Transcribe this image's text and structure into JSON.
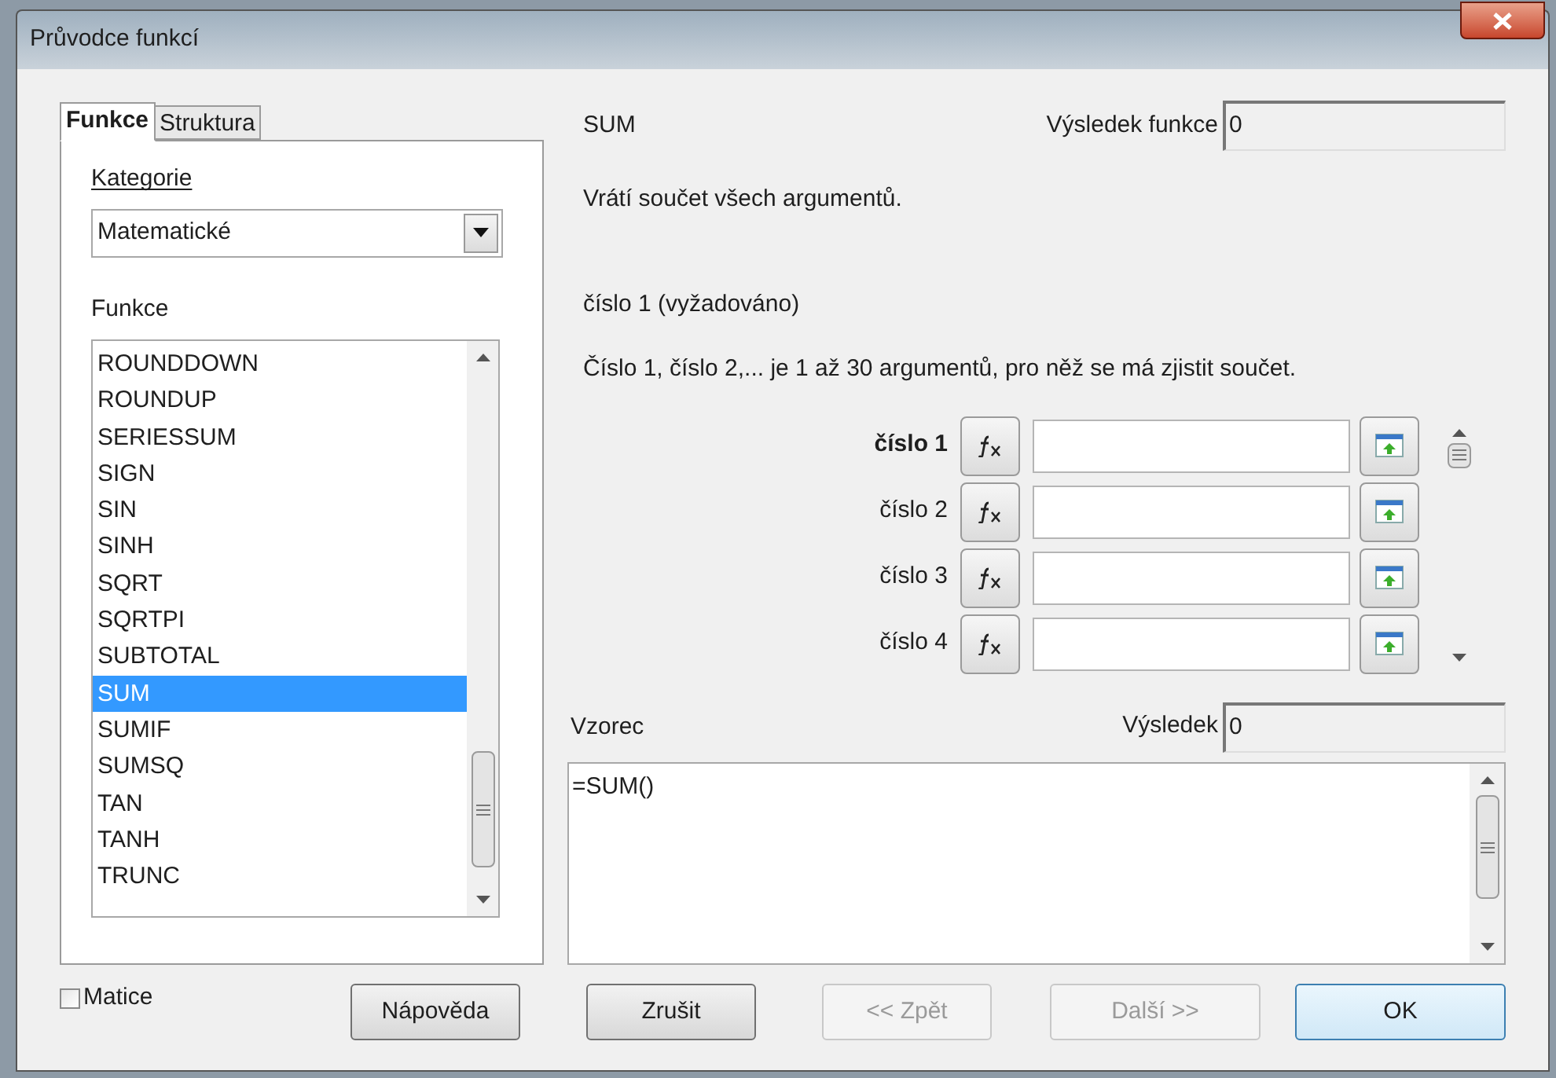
{
  "window": {
    "title": "Průvodce funkcí"
  },
  "tabs": [
    {
      "label": "Funkce",
      "selected": true
    },
    {
      "label": "Struktura",
      "selected": false
    }
  ],
  "category": {
    "label": "Kategorie",
    "value": "Matematické"
  },
  "functions": {
    "label": "Funkce",
    "items": [
      {
        "label": "ROUNDDOWN",
        "selected": false
      },
      {
        "label": "ROUNDUP",
        "selected": false
      },
      {
        "label": "SERIESSUM",
        "selected": false
      },
      {
        "label": "SIGN",
        "selected": false
      },
      {
        "label": "SIN",
        "selected": false
      },
      {
        "label": "SINH",
        "selected": false
      },
      {
        "label": "SQRT",
        "selected": false
      },
      {
        "label": "SQRTPI",
        "selected": false
      },
      {
        "label": "SUBTOTAL",
        "selected": false
      },
      {
        "label": "SUM",
        "selected": true
      },
      {
        "label": "SUMIF",
        "selected": false
      },
      {
        "label": "SUMSQ",
        "selected": false
      },
      {
        "label": "TAN",
        "selected": false
      },
      {
        "label": "TANH",
        "selected": false
      },
      {
        "label": "TRUNC",
        "selected": false
      }
    ]
  },
  "matrix": {
    "label": "Matice",
    "checked": false
  },
  "function_name": "SUM",
  "function_result": {
    "label": "Výsledek funkce",
    "value": "0"
  },
  "description": "Vrátí součet všech argumentů.",
  "argument_title": "číslo 1 (vyžadováno)",
  "argument_description": "Číslo 1, číslo 2,... je 1 až 30 argumentů, pro něž se má zjistit součet.",
  "arguments": [
    {
      "label": "číslo 1",
      "selected": true
    },
    {
      "label": "číslo 2",
      "selected": false
    },
    {
      "label": "číslo 3",
      "selected": false
    },
    {
      "label": "číslo 4",
      "selected": false
    }
  ],
  "formula": {
    "label": "Vzorec",
    "value": "=SUM()"
  },
  "result": {
    "label": "Výsledek",
    "value": "0"
  },
  "buttons": [
    {
      "label": "Nápověda",
      "disabled": false,
      "default": false
    },
    {
      "label": "Zrušit",
      "disabled": false,
      "default": false
    },
    {
      "label": "<< Zpět",
      "disabled": true,
      "default": false
    },
    {
      "label": "Další >>",
      "disabled": true,
      "default": false
    },
    {
      "label": "OK",
      "disabled": false,
      "default": true
    }
  ]
}
